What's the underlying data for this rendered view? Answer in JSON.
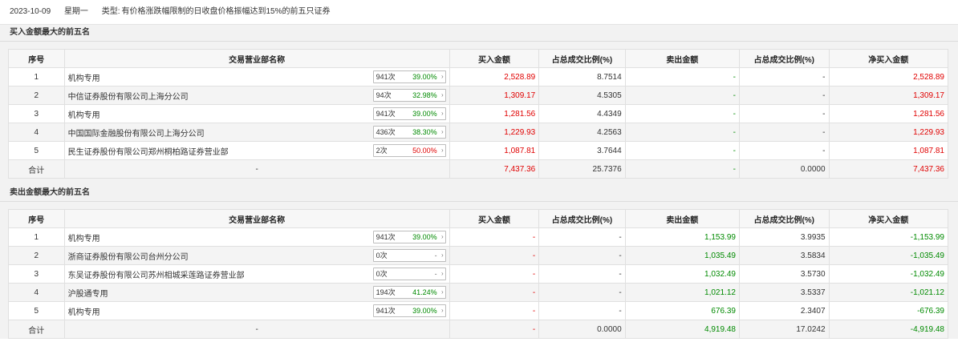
{
  "header": {
    "date": "2023-10-09",
    "weekday": "星期一",
    "type_label": "类型:",
    "type_desc": "有价格涨跌幅限制的日收盘价格振幅达到15%的前五只证券"
  },
  "columns": [
    "序号",
    "交易营业部名称",
    "买入金额",
    "占总成交比例(%)",
    "卖出金额",
    "占总成交比例(%)",
    "净买入金额"
  ],
  "buy_section": {
    "title": "买入金额最大的前五名",
    "rows": [
      {
        "idx": "1",
        "name": "机构专用",
        "count": "941次",
        "pct": "39.00%",
        "pct_color": "green",
        "buy": "2,528.89",
        "buy_ratio": "8.7514",
        "sell": "-",
        "sell_ratio": "-",
        "net": "2,528.89"
      },
      {
        "idx": "2",
        "name": "中信证券股份有限公司上海分公司",
        "count": "94次",
        "pct": "32.98%",
        "pct_color": "green",
        "buy": "1,309.17",
        "buy_ratio": "4.5305",
        "sell": "-",
        "sell_ratio": "-",
        "net": "1,309.17"
      },
      {
        "idx": "3",
        "name": "机构专用",
        "count": "941次",
        "pct": "39.00%",
        "pct_color": "green",
        "buy": "1,281.56",
        "buy_ratio": "4.4349",
        "sell": "-",
        "sell_ratio": "-",
        "net": "1,281.56"
      },
      {
        "idx": "4",
        "name": "中国国际金融股份有限公司上海分公司",
        "count": "436次",
        "pct": "38.30%",
        "pct_color": "green",
        "buy": "1,229.93",
        "buy_ratio": "4.2563",
        "sell": "-",
        "sell_ratio": "-",
        "net": "1,229.93"
      },
      {
        "idx": "5",
        "name": "民生证券股份有限公司郑州桐柏路证券营业部",
        "count": "2次",
        "pct": "50.00%",
        "pct_color": "red",
        "buy": "1,087.81",
        "buy_ratio": "3.7644",
        "sell": "-",
        "sell_ratio": "-",
        "net": "1,087.81"
      }
    ],
    "total": {
      "label": "合计",
      "name": "-",
      "buy": "7,437.36",
      "buy_ratio": "25.7376",
      "sell": "-",
      "sell_ratio": "0.0000",
      "net": "7,437.36"
    }
  },
  "sell_section": {
    "title": "卖出金额最大的前五名",
    "rows": [
      {
        "idx": "1",
        "name": "机构专用",
        "count": "941次",
        "pct": "39.00%",
        "pct_color": "green",
        "buy": "-",
        "buy_ratio": "-",
        "sell": "1,153.99",
        "sell_ratio": "3.9935",
        "net": "-1,153.99"
      },
      {
        "idx": "2",
        "name": "浙商证券股份有限公司台州分公司",
        "count": "0次",
        "pct": "-",
        "pct_color": "gray",
        "buy": "-",
        "buy_ratio": "-",
        "sell": "1,035.49",
        "sell_ratio": "3.5834",
        "net": "-1,035.49"
      },
      {
        "idx": "3",
        "name": "东吴证券股份有限公司苏州相城采莲路证券营业部",
        "count": "0次",
        "pct": "-",
        "pct_color": "gray",
        "buy": "-",
        "buy_ratio": "-",
        "sell": "1,032.49",
        "sell_ratio": "3.5730",
        "net": "-1,032.49"
      },
      {
        "idx": "4",
        "name": "沪股通专用",
        "count": "194次",
        "pct": "41.24%",
        "pct_color": "green",
        "buy": "-",
        "buy_ratio": "-",
        "sell": "1,021.12",
        "sell_ratio": "3.5337",
        "net": "-1,021.12"
      },
      {
        "idx": "5",
        "name": "机构专用",
        "count": "941次",
        "pct": "39.00%",
        "pct_color": "green",
        "buy": "-",
        "buy_ratio": "-",
        "sell": "676.39",
        "sell_ratio": "2.3407",
        "net": "-676.39"
      }
    ],
    "total": {
      "label": "合计",
      "name": "-",
      "buy": "-",
      "buy_ratio": "0.0000",
      "sell": "4,919.48",
      "sell_ratio": "17.0242",
      "net": "-4,919.48"
    }
  }
}
